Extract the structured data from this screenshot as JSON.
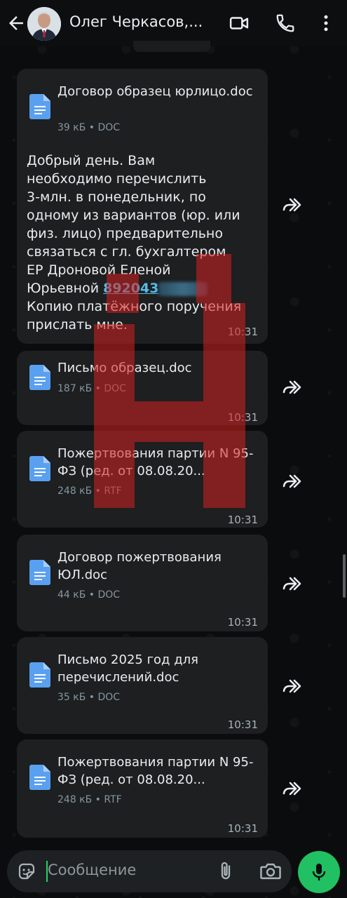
{
  "header": {
    "contact_name": "Олег Черкасов,...",
    "icons": [
      "back-arrow-icon",
      "avatar",
      "video-call-icon",
      "phone-icon",
      "more-vert-icon"
    ]
  },
  "messages": [
    {
      "file_name": "Договор образец юрлицо.doc",
      "file_meta": "39 кБ • DOC",
      "text_lines": [
        "Добрый день. Вам",
        "необходимо перечислить",
        "3-млн. в понедельник, по",
        "одному из вариантов (юр. или",
        "физ. лицо) предварительно",
        "связаться с гл. бухгалтером",
        "ЕР Дроновой Еленой",
        "Юрьевной"
      ],
      "phone": "892043",
      "text_after": [
        "Копию платёжного поручения",
        "прислать мне."
      ],
      "time": "10:31"
    },
    {
      "file_name": "Письмо образец.doc",
      "file_meta": "187 кБ • DOC",
      "time": "10:31"
    },
    {
      "file_name": "Пожертвования партии N 95-ФЗ (ред. от 08.08.20...",
      "file_meta": "248 кБ • RTF",
      "time": "10:31"
    },
    {
      "file_name": "Договор пожертвования ЮЛ.doc",
      "file_meta": "44 кБ • DOC",
      "time": "10:31"
    },
    {
      "file_name": "Письмо 2025 год для перечислений.doc",
      "file_meta": "35 кБ • DOC",
      "time": "10:31"
    },
    {
      "file_name": "Пожертвования партии N 95-ФЗ (ред. от 08.08.20...",
      "file_meta": "248 кБ • RTF",
      "time": "10:31"
    }
  ],
  "composer": {
    "placeholder": "Сообщение"
  },
  "colors": {
    "bubble": "#1d1f20",
    "accent": "#21c063",
    "link": "#53bdeb",
    "doc_icon": "#5aa0f0",
    "watermark": "#d62020"
  }
}
